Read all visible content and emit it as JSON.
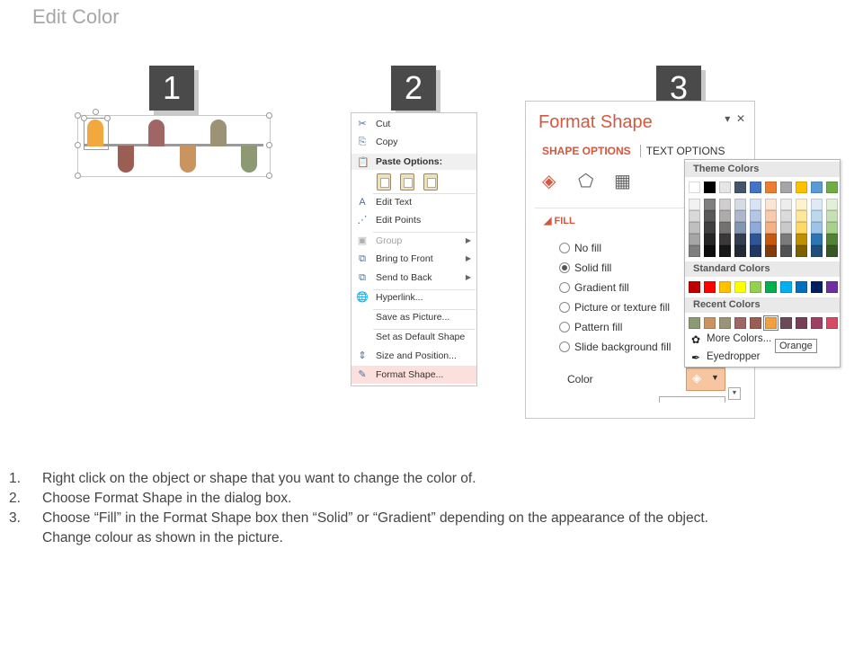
{
  "title": "Edit Color",
  "steps": [
    "1",
    "2",
    "3"
  ],
  "colors": {
    "accent": "#d2583f",
    "pill_colors": [
      "#f3a73f",
      "#9a5e55",
      "#a06565",
      "#c9945f",
      "#9c9275",
      "#8d9973"
    ],
    "selected_swatch": "#f0a040"
  },
  "context_menu": {
    "items": [
      {
        "label": "Cut",
        "icon": "scissors-icon",
        "glyph": "✂"
      },
      {
        "label": "Copy",
        "icon": "copy-icon",
        "glyph": "⎘"
      },
      {
        "label": "Edit Text",
        "icon": "edit-text-icon",
        "glyph": "A"
      },
      {
        "label": "Edit Points",
        "icon": "edit-points-icon",
        "glyph": "⋰"
      },
      {
        "label": "Group",
        "icon": "group-icon",
        "glyph": "▣"
      },
      {
        "label": "Bring to Front",
        "icon": "bring-to-front-icon",
        "glyph": "⧉"
      },
      {
        "label": "Send to Back",
        "icon": "send-to-back-icon",
        "glyph": "⧉"
      },
      {
        "label": "Hyperlink...",
        "icon": "hyperlink-icon",
        "glyph": "🌐"
      },
      {
        "label": "Save as Picture...",
        "icon": "",
        "glyph": ""
      },
      {
        "label": "Set as Default Shape",
        "icon": "",
        "glyph": ""
      },
      {
        "label": "Size and Position...",
        "icon": "size-position-icon",
        "glyph": "⇕"
      },
      {
        "label": "Format Shape...",
        "icon": "format-shape-icon",
        "glyph": "✎"
      }
    ],
    "paste_options_label": "Paste Options:"
  },
  "format_shape": {
    "title": "Format Shape",
    "tab_shape_options": "SHAPE OPTIONS",
    "tab_text_options": "TEXT OPTIONS",
    "fill_section": "FILL",
    "fill_options": [
      "No fill",
      "Solid fill",
      "Gradient fill",
      "Picture or texture fill",
      "Pattern fill",
      "Slide background fill"
    ],
    "selected_fill": "Solid fill",
    "color_label": "Color"
  },
  "color_picker": {
    "theme_colors_label": "Theme Colors",
    "standard_colors_label": "Standard Colors",
    "recent_colors_label": "Recent Colors",
    "theme_top": [
      "#ffffff",
      "#000000",
      "#e7e6e6",
      "#44546a",
      "#4472c4",
      "#ed7d31",
      "#a5a5a5",
      "#ffc000",
      "#5b9bd5",
      "#70ad47"
    ],
    "theme_shades": [
      [
        "#f2f2f2",
        "#808080",
        "#d0cece",
        "#d6dce4",
        "#dae3f3",
        "#fbe5d6",
        "#ededed",
        "#fff2cc",
        "#deebf7",
        "#e2f0d9"
      ],
      [
        "#d9d9d9",
        "#595959",
        "#aeabab",
        "#adb9ca",
        "#b4c7e7",
        "#f8cbad",
        "#dbdbdb",
        "#ffe699",
        "#bdd7ee",
        "#c5e0b4"
      ],
      [
        "#bfbfbf",
        "#404040",
        "#757171",
        "#8497b0",
        "#8faadc",
        "#f4b183",
        "#c9c9c9",
        "#ffd966",
        "#9dc3e6",
        "#a9d18e"
      ],
      [
        "#a6a6a6",
        "#262626",
        "#3a3838",
        "#333f50",
        "#2f5597",
        "#c55a11",
        "#7b7b7b",
        "#bf9000",
        "#2e75b6",
        "#548235"
      ],
      [
        "#7f7f7f",
        "#0d0d0d",
        "#171616",
        "#222a35",
        "#203864",
        "#843c0c",
        "#525252",
        "#7f6000",
        "#1f4e79",
        "#385723"
      ]
    ],
    "standard": [
      "#c00000",
      "#ff0000",
      "#ffc000",
      "#ffff00",
      "#92d050",
      "#00b050",
      "#00b0f0",
      "#0070c0",
      "#002060",
      "#7030a0"
    ],
    "recent": [
      "#8d9973",
      "#c9945f",
      "#9c9275",
      "#a06565",
      "#9a5e55",
      "#f0a040",
      "#6b4a5a",
      "#7a3f55",
      "#a04060",
      "#d64a63"
    ],
    "more_colors_label": "More Colors...",
    "eyedropper_label": "Eyedropper",
    "tooltip": "Orange"
  },
  "instructions": [
    {
      "num": "1.",
      "text": "Right click on the object or shape that you want to change the color of."
    },
    {
      "num": "2.",
      "text": "Choose Format Shape in the dialog box."
    },
    {
      "num": "3.",
      "text": "Choose “Fill” in the Format Shape box then “Solid” or “Gradient” depending on the appearance of the object."
    },
    {
      "num": "",
      "text": "Change colour as shown in the picture."
    }
  ]
}
